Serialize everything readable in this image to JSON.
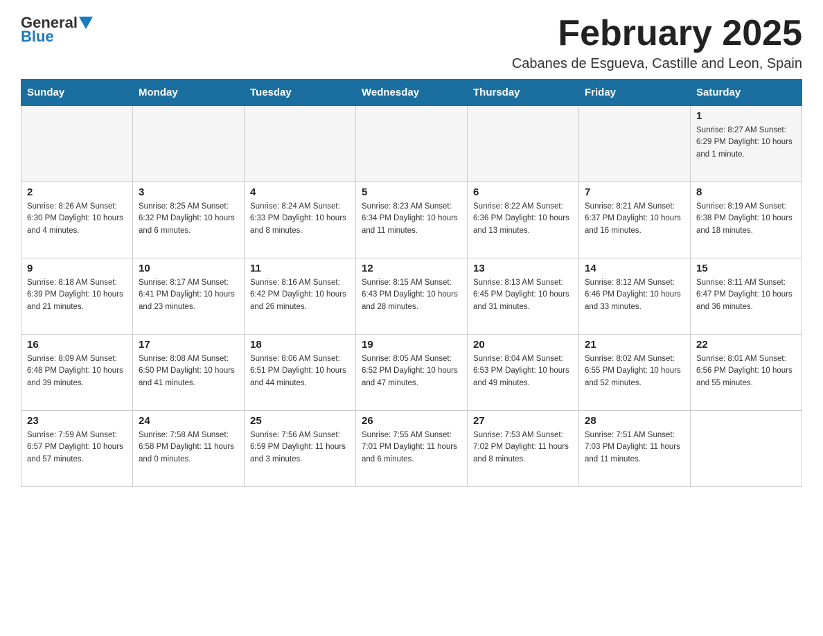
{
  "header": {
    "logo_general": "General",
    "logo_blue": "Blue",
    "month_title": "February 2025",
    "location": "Cabanes de Esgueva, Castille and Leon, Spain"
  },
  "days_of_week": [
    "Sunday",
    "Monday",
    "Tuesday",
    "Wednesday",
    "Thursday",
    "Friday",
    "Saturday"
  ],
  "weeks": [
    {
      "days": [
        {
          "number": "",
          "info": ""
        },
        {
          "number": "",
          "info": ""
        },
        {
          "number": "",
          "info": ""
        },
        {
          "number": "",
          "info": ""
        },
        {
          "number": "",
          "info": ""
        },
        {
          "number": "",
          "info": ""
        },
        {
          "number": "1",
          "info": "Sunrise: 8:27 AM\nSunset: 6:29 PM\nDaylight: 10 hours and 1 minute."
        }
      ]
    },
    {
      "days": [
        {
          "number": "2",
          "info": "Sunrise: 8:26 AM\nSunset: 6:30 PM\nDaylight: 10 hours and 4 minutes."
        },
        {
          "number": "3",
          "info": "Sunrise: 8:25 AM\nSunset: 6:32 PM\nDaylight: 10 hours and 6 minutes."
        },
        {
          "number": "4",
          "info": "Sunrise: 8:24 AM\nSunset: 6:33 PM\nDaylight: 10 hours and 8 minutes."
        },
        {
          "number": "5",
          "info": "Sunrise: 8:23 AM\nSunset: 6:34 PM\nDaylight: 10 hours and 11 minutes."
        },
        {
          "number": "6",
          "info": "Sunrise: 8:22 AM\nSunset: 6:36 PM\nDaylight: 10 hours and 13 minutes."
        },
        {
          "number": "7",
          "info": "Sunrise: 8:21 AM\nSunset: 6:37 PM\nDaylight: 10 hours and 16 minutes."
        },
        {
          "number": "8",
          "info": "Sunrise: 8:19 AM\nSunset: 6:38 PM\nDaylight: 10 hours and 18 minutes."
        }
      ]
    },
    {
      "days": [
        {
          "number": "9",
          "info": "Sunrise: 8:18 AM\nSunset: 6:39 PM\nDaylight: 10 hours and 21 minutes."
        },
        {
          "number": "10",
          "info": "Sunrise: 8:17 AM\nSunset: 6:41 PM\nDaylight: 10 hours and 23 minutes."
        },
        {
          "number": "11",
          "info": "Sunrise: 8:16 AM\nSunset: 6:42 PM\nDaylight: 10 hours and 26 minutes."
        },
        {
          "number": "12",
          "info": "Sunrise: 8:15 AM\nSunset: 6:43 PM\nDaylight: 10 hours and 28 minutes."
        },
        {
          "number": "13",
          "info": "Sunrise: 8:13 AM\nSunset: 6:45 PM\nDaylight: 10 hours and 31 minutes."
        },
        {
          "number": "14",
          "info": "Sunrise: 8:12 AM\nSunset: 6:46 PM\nDaylight: 10 hours and 33 minutes."
        },
        {
          "number": "15",
          "info": "Sunrise: 8:11 AM\nSunset: 6:47 PM\nDaylight: 10 hours and 36 minutes."
        }
      ]
    },
    {
      "days": [
        {
          "number": "16",
          "info": "Sunrise: 8:09 AM\nSunset: 6:48 PM\nDaylight: 10 hours and 39 minutes."
        },
        {
          "number": "17",
          "info": "Sunrise: 8:08 AM\nSunset: 6:50 PM\nDaylight: 10 hours and 41 minutes."
        },
        {
          "number": "18",
          "info": "Sunrise: 8:06 AM\nSunset: 6:51 PM\nDaylight: 10 hours and 44 minutes."
        },
        {
          "number": "19",
          "info": "Sunrise: 8:05 AM\nSunset: 6:52 PM\nDaylight: 10 hours and 47 minutes."
        },
        {
          "number": "20",
          "info": "Sunrise: 8:04 AM\nSunset: 6:53 PM\nDaylight: 10 hours and 49 minutes."
        },
        {
          "number": "21",
          "info": "Sunrise: 8:02 AM\nSunset: 6:55 PM\nDaylight: 10 hours and 52 minutes."
        },
        {
          "number": "22",
          "info": "Sunrise: 8:01 AM\nSunset: 6:56 PM\nDaylight: 10 hours and 55 minutes."
        }
      ]
    },
    {
      "days": [
        {
          "number": "23",
          "info": "Sunrise: 7:59 AM\nSunset: 6:57 PM\nDaylight: 10 hours and 57 minutes."
        },
        {
          "number": "24",
          "info": "Sunrise: 7:58 AM\nSunset: 6:58 PM\nDaylight: 11 hours and 0 minutes."
        },
        {
          "number": "25",
          "info": "Sunrise: 7:56 AM\nSunset: 6:59 PM\nDaylight: 11 hours and 3 minutes."
        },
        {
          "number": "26",
          "info": "Sunrise: 7:55 AM\nSunset: 7:01 PM\nDaylight: 11 hours and 6 minutes."
        },
        {
          "number": "27",
          "info": "Sunrise: 7:53 AM\nSunset: 7:02 PM\nDaylight: 11 hours and 8 minutes."
        },
        {
          "number": "28",
          "info": "Sunrise: 7:51 AM\nSunset: 7:03 PM\nDaylight: 11 hours and 11 minutes."
        },
        {
          "number": "",
          "info": ""
        }
      ]
    }
  ]
}
